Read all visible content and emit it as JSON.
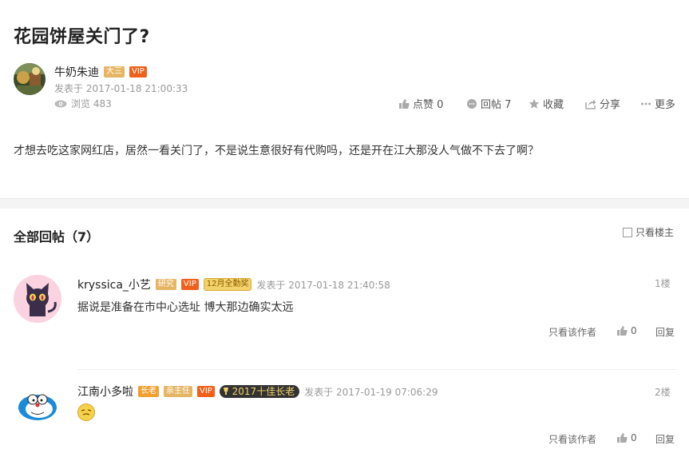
{
  "post": {
    "title": "花园饼屋关门了?",
    "author": {
      "name": "牛奶朱迪",
      "badges": [
        "大三",
        "VIP"
      ],
      "time": "发表于 2017-01-18 21:00:33",
      "views": "浏览 483"
    },
    "actions": {
      "like": "点赞 0",
      "reply": "回帖 7",
      "collect": "收藏",
      "share": "分享",
      "more": "更多"
    },
    "content": "才想去吃这家网红店，居然一看关门了，不是说生意很好有代购吗，还是开在江大那没人气做不下去了啊？"
  },
  "replies_section": {
    "title": "全部回帖（7）",
    "only_op_label": "只看楼主"
  },
  "replies": [
    {
      "name": "kryssica_小艺",
      "badges": [
        "研究",
        "VIP",
        "12月全勤奖"
      ],
      "time": "发表于 2017-01-18 21:40:58",
      "floor": "1楼",
      "text": "据说是准备在市中心选址 博大那边确实太远",
      "only_author": "只看该作者",
      "likes": "0",
      "reply": "回复"
    },
    {
      "name": "江南小多啦",
      "badges": [
        "长老",
        "亲主任",
        "VIP",
        "2017十佳长老"
      ],
      "time": "发表于 2017-01-19 07:06:29",
      "floor": "2楼",
      "text": "",
      "only_author": "只看该作者",
      "likes": "0",
      "reply": "回复"
    }
  ],
  "icons": {
    "views": "eye-icon",
    "like": "thumb-up-icon",
    "reply": "comment-icon",
    "collect": "star-icon",
    "share": "share-icon",
    "more": "more-dots-icon"
  },
  "colors": {
    "vip": "#f0601b",
    "grade": "#e5b562",
    "divider": "#f4f4f4"
  }
}
